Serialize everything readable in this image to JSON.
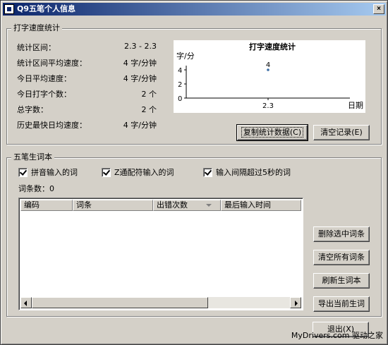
{
  "window": {
    "title": "Q9五笔个人信息",
    "close_label": "×"
  },
  "speed_stats": {
    "group_title": "打字速度统计",
    "rows": [
      {
        "label": "统计区间：",
        "value": "2.3 - 2.3"
      },
      {
        "label": "统计区间平均速度：",
        "value": "4 字/分钟"
      },
      {
        "label": "今日平均速度：",
        "value": "4 字/分钟"
      },
      {
        "label": "今日打字个数：",
        "value": "2 个"
      },
      {
        "label": "总字数：",
        "value": "2 个"
      },
      {
        "label": "历史最快日均速度：",
        "value": "4 字/分钟"
      }
    ],
    "copy_button": "复制统计数据(C)",
    "clear_button": "清空记录(E)"
  },
  "chart_data": {
    "type": "scatter",
    "title": "打字速度统计",
    "xlabel": "日期",
    "ylabel": "字/分",
    "categories": [
      "2.3"
    ],
    "y_ticks": [
      "0",
      "2",
      "4"
    ],
    "ylim": [
      0,
      4
    ],
    "series": [
      {
        "values": [
          4
        ]
      }
    ],
    "data_labels": [
      "4"
    ],
    "point_color": "#3a6ea5"
  },
  "word_book": {
    "group_title": "五笔生词本",
    "checkboxes": [
      {
        "label": "拼音输入的词",
        "checked": true
      },
      {
        "label": "Z通配符输入的词",
        "checked": true
      },
      {
        "label": "输入间隔超过5秒的词",
        "checked": true
      }
    ],
    "count_label": "词条数：0",
    "columns": [
      "编码",
      "词条",
      "出错次数",
      "最后输入时间"
    ],
    "rows": [],
    "buttons": {
      "delete_selected": "删除选中词条",
      "clear_all": "清空所有词条",
      "refresh": "刷新生词本",
      "export": "导出当前生词"
    }
  },
  "footer": {
    "exit_button": "退出(X)",
    "watermark": "MyDrivers.com 驱动之家"
  }
}
